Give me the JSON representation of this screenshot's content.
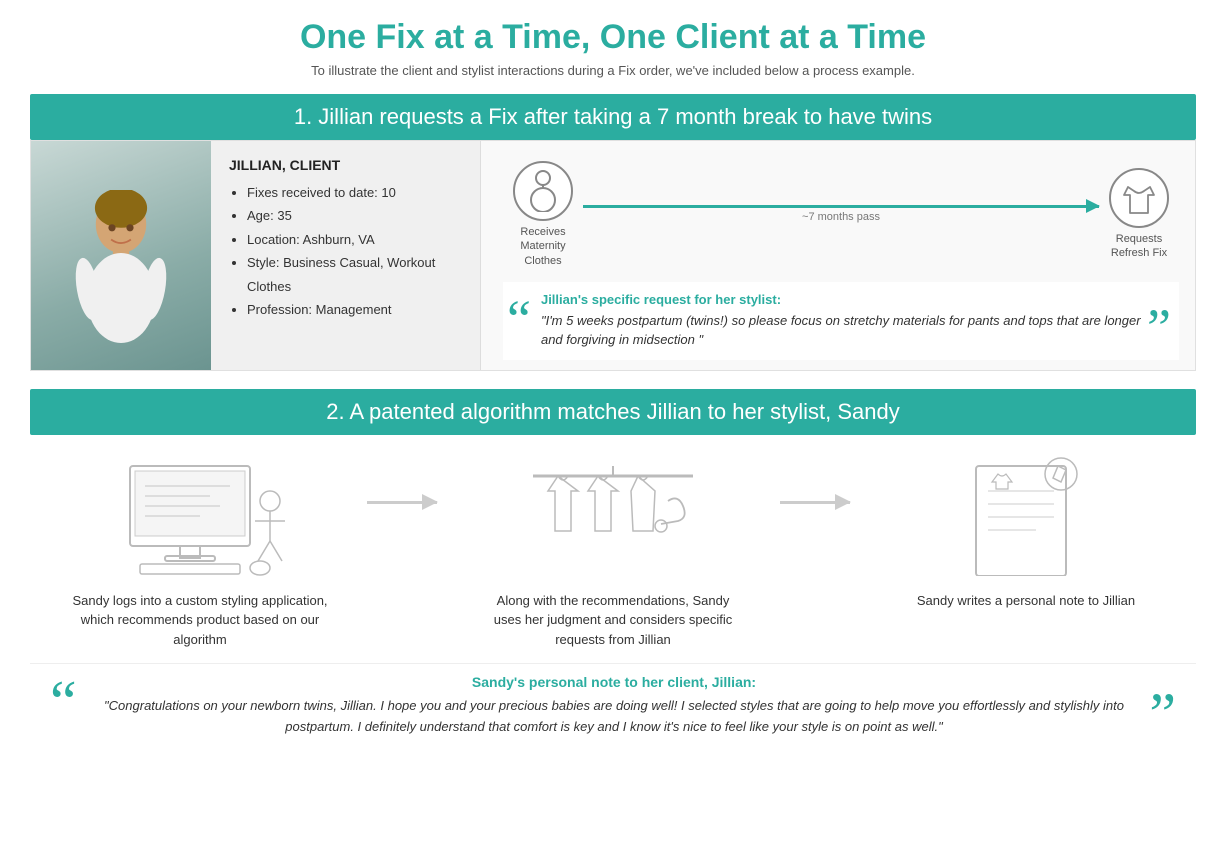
{
  "header": {
    "main_title": "One Fix at a Time, One Client at a Time",
    "subtitle": "To illustrate the client and stylist interactions during a Fix order, we've included below a process example."
  },
  "section1": {
    "header": "1. Jillian requests a Fix after taking a 7 month break to have twins",
    "client": {
      "name": "JILLIAN, CLIENT",
      "details": [
        "Fixes received to date: 10",
        "Age: 35",
        "Location: Ashburn, VA",
        "Style: Business Casual, Workout Clothes",
        "Profession: Management"
      ]
    },
    "timeline": {
      "step1_label": "Receives Maternity Clothes",
      "step2_label": "~7 months pass",
      "step3_label": "Requests Refresh Fix"
    },
    "quote": {
      "author": "Jillian's specific request for her stylist:",
      "text": "\"I'm 5 weeks postpartum (twins!) so please focus on stretchy materials for pants and tops that are longer and forgiving in midsection \""
    }
  },
  "section2": {
    "header": "2. A patented algorithm matches Jillian to her stylist, Sandy",
    "steps": [
      {
        "id": "step1",
        "caption": "Sandy logs into a custom styling application, which recommends product based on our algorithm"
      },
      {
        "id": "step2",
        "caption": "Along with the recommendations, Sandy uses her judgment and considers specific requests from Jillian"
      },
      {
        "id": "step3",
        "caption": "Sandy writes a personal note to Jillian"
      }
    ],
    "sandy_quote": {
      "author": "Sandy's personal note to her client, Jillian:",
      "text": "\"Congratulations on your newborn twins, Jillian. I hope you and your precious babies are doing well! I selected styles that are going to help move you effortlessly and stylishly into postpartum. I definitely understand that comfort is key and I know it's nice to feel like your style is on point as well.\""
    }
  },
  "colors": {
    "teal": "#2bada0",
    "light_gray": "#ccc",
    "dark_text": "#333"
  }
}
